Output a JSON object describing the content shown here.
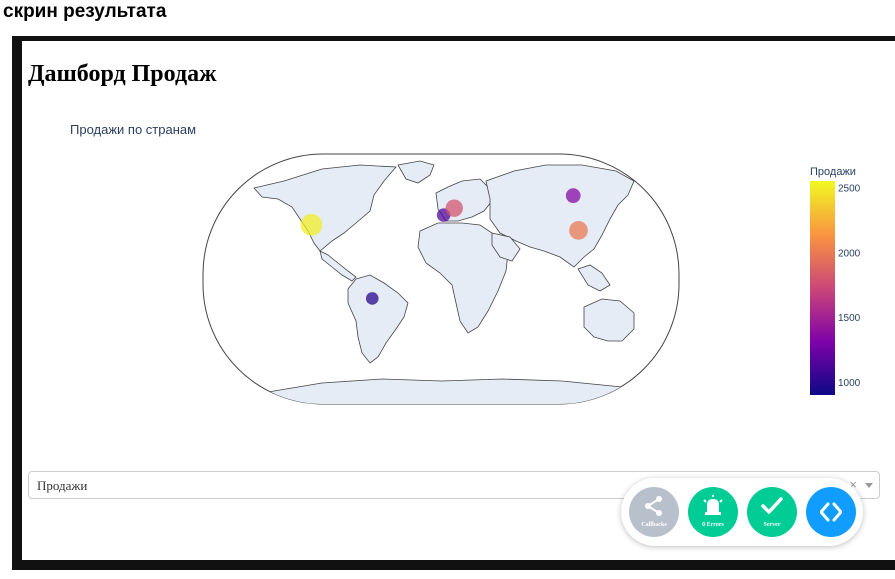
{
  "caption": "скрин результата",
  "dashboard": {
    "title": "Дашборд Продаж"
  },
  "chart_data": {
    "type": "scattergeo",
    "title": "Продажи по странам",
    "projection": "natural earth",
    "colorscale": "Plasma",
    "colorbar": {
      "title": "Продажи",
      "ticks": [
        "2500",
        "2000",
        "1500",
        "1000"
      ],
      "range": [
        900,
        2550
      ]
    },
    "points": [
      {
        "location": "USA",
        "lon": -98,
        "lat": 39,
        "value": 2500
      },
      {
        "location": "Brazil",
        "lon": -52,
        "lat": -14,
        "value": 1000
      },
      {
        "location": "France",
        "lon": 2,
        "lat": 46,
        "value": 1150
      },
      {
        "location": "Germany",
        "lon": 10,
        "lat": 51,
        "value": 1800
      },
      {
        "location": "Russia",
        "lon": 100,
        "lat": 60,
        "value": 1350
      },
      {
        "location": "China",
        "lon": 104,
        "lat": 35,
        "value": 2000
      }
    ]
  },
  "dropdown": {
    "value": "Продажи",
    "clear": "×"
  },
  "devtools": {
    "callbacks_label": "Callbacks",
    "errors_label": "0 Errors",
    "server_label": "Server",
    "colors": {
      "callbacks": "#b8c0cc",
      "errors": "#00cc96",
      "server": "#00cc96",
      "code": "#119dff"
    }
  }
}
